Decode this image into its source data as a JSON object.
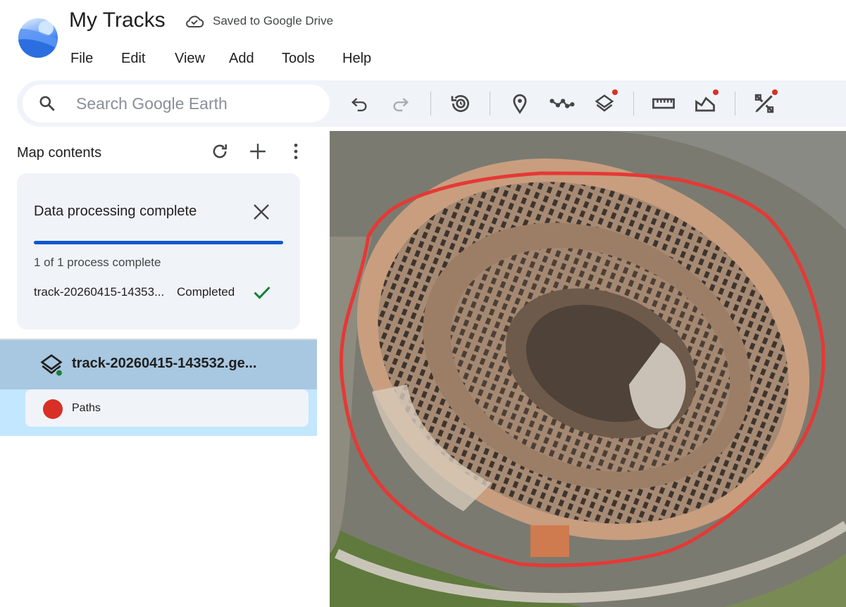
{
  "app": {
    "title": "My Tracks",
    "save_status": "Saved to Google Drive",
    "brand_color": "#4285f4"
  },
  "menu": [
    "File",
    "Edit",
    "View",
    "Add",
    "Tools",
    "Help"
  ],
  "search": {
    "placeholder": "Search Google Earth",
    "value": ""
  },
  "toolbar": [
    {
      "icon": "undo-icon"
    },
    {
      "icon": "redo-icon",
      "disabled": true
    },
    {
      "icon": "historical-imagery-icon"
    },
    {
      "icon": "placemark-icon"
    },
    {
      "icon": "path-icon"
    },
    {
      "icon": "layers-icon",
      "badge": true
    },
    {
      "icon": "measure-icon"
    },
    {
      "icon": "elevation-profile-icon",
      "badge": true
    },
    {
      "icon": "design-tools-icon",
      "badge": true
    }
  ],
  "sidebar": {
    "title": "Map contents",
    "processing_card": {
      "title": "Data processing complete",
      "progress_fraction": 1.0,
      "status": "1 of 1 process complete",
      "file": "track-20260415-14353...",
      "file_status": "Completed"
    },
    "layer": {
      "name": "track-20260415-143532.ge..."
    },
    "sublayer": {
      "label": "Paths",
      "color": "#d93025"
    }
  },
  "map": {
    "track_color": "#e53935"
  }
}
